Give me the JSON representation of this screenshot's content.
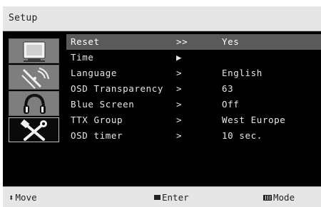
{
  "header": {
    "title": "Setup"
  },
  "sidebar": {
    "items": [
      {
        "icon": "tv-icon",
        "active": false
      },
      {
        "icon": "antenna-icon",
        "active": false
      },
      {
        "icon": "headphones-icon",
        "active": false
      },
      {
        "icon": "tools-icon",
        "active": true
      }
    ]
  },
  "menu": {
    "items": [
      {
        "label": "Reset",
        "arrow": ">>",
        "value": "Yes",
        "selected": true
      },
      {
        "label": "Time",
        "arrow": "▶",
        "value": "",
        "selected": false
      },
      {
        "label": "Language",
        "arrow": ">",
        "value": "English",
        "selected": false
      },
      {
        "label": "OSD Transparency",
        "arrow": ">",
        "value": "63",
        "selected": false
      },
      {
        "label": "Blue Screen",
        "arrow": ">",
        "value": "Off",
        "selected": false
      },
      {
        "label": "TTX Group",
        "arrow": ">",
        "value": "West Europe",
        "selected": false
      },
      {
        "label": "OSD timer",
        "arrow": ">",
        "value": "10 sec.",
        "selected": false
      }
    ]
  },
  "footer": {
    "move": {
      "icon": "up-down-arrows-icon",
      "glyph": "⬍",
      "label": "Move"
    },
    "enter": {
      "icon": "enter-key-icon",
      "label": "Enter"
    },
    "mode": {
      "icon": "mode-key-icon",
      "label": "Mode"
    }
  },
  "colors": {
    "background": "#000000",
    "bar": "#e6e6e6",
    "selection": "#5a5a5a",
    "text": "#e6e6e6"
  }
}
